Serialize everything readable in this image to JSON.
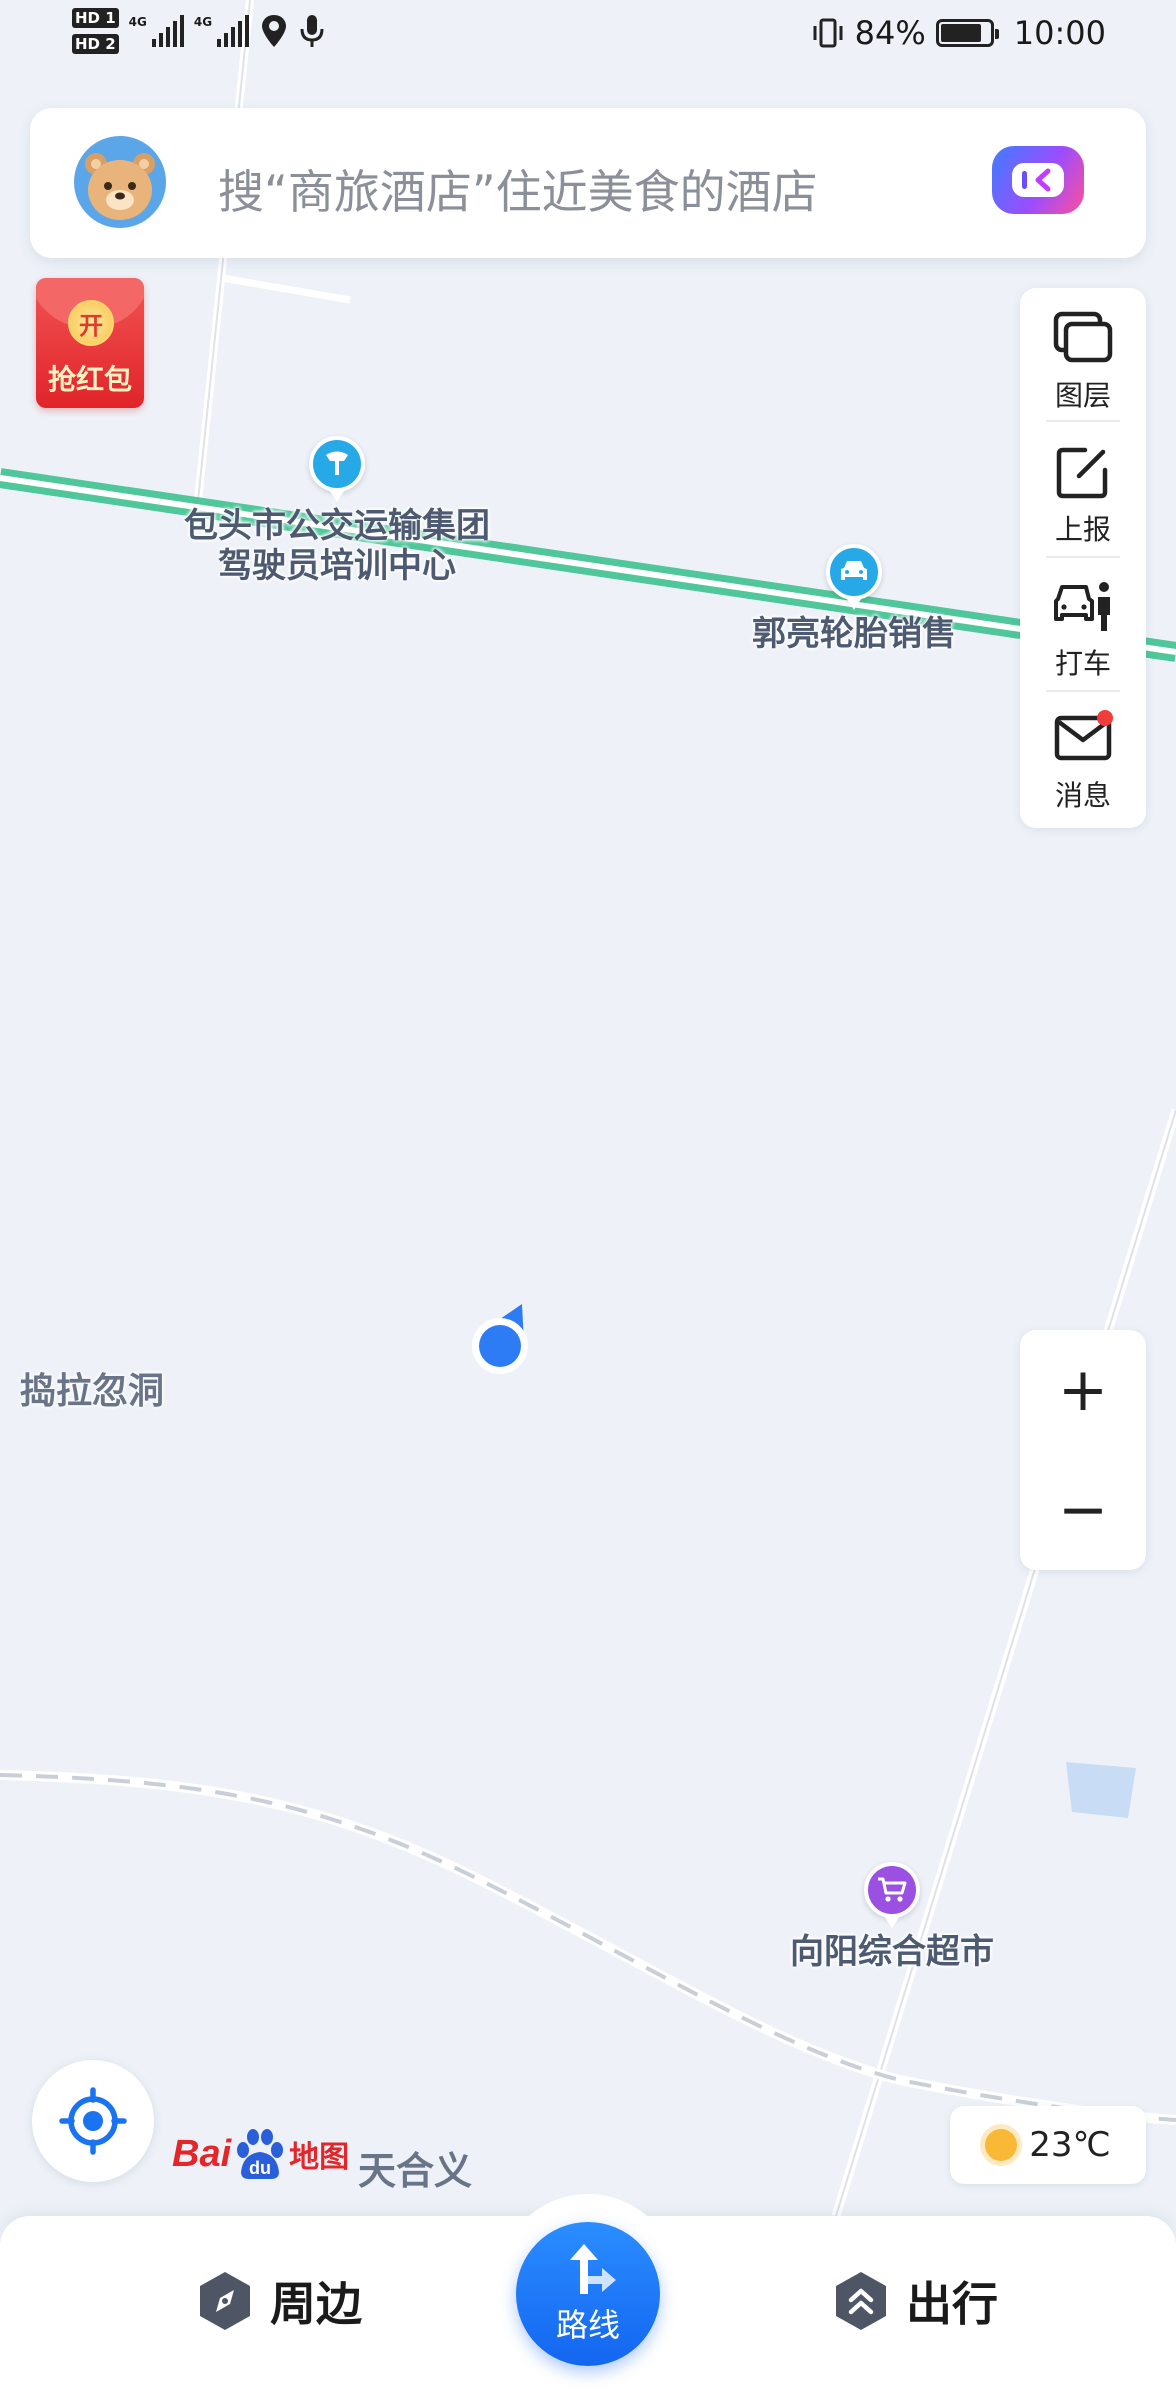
{
  "status_bar": {
    "hd1": "HD 1",
    "hd2": "HD 2",
    "net1": "4G",
    "net2": "4G",
    "battery": "84%",
    "battery_level": 0.84,
    "time": "10:00"
  },
  "search": {
    "placeholder": "搜“商旅酒店”住近美食的酒店"
  },
  "red_packet": {
    "coin": "开",
    "label": "抢红包"
  },
  "tools": [
    {
      "label": "图层",
      "icon": "layers-icon"
    },
    {
      "label": "上报",
      "icon": "report-edit-icon"
    },
    {
      "label": "打车",
      "icon": "taxi-icon"
    },
    {
      "label": "消息",
      "icon": "message-icon"
    }
  ],
  "map": {
    "pois": [
      {
        "name": "包头市公交运输集团\n驾驶员培训中心",
        "line1": "包头市公交运输集团",
        "line2": "驾驶员培训中心",
        "icon": "training-icon",
        "color": "#27a9e8"
      },
      {
        "name": "郭亮轮胎销售",
        "icon": "car-icon",
        "color": "#27a9e8"
      },
      {
        "name": "向阳综合超市",
        "icon": "shopping-cart-icon",
        "color": "#9a50e0"
      }
    ],
    "places": [
      "捣拉忽洞"
    ],
    "current_location": "天合义"
  },
  "zoom": {
    "in": "+",
    "out": "−"
  },
  "logo": {
    "bai": "Bai",
    "du": "du",
    "ditu": "地图"
  },
  "weather": {
    "temp": "23℃"
  },
  "bottom_nav": {
    "nearby": "周边",
    "route": "路线",
    "travel": "出行"
  },
  "colors": {
    "map_bg": "#eef2f8",
    "rail": "#4fc79a",
    "accent": "#1a73f0",
    "location_dot": "#2d7cf6"
  }
}
